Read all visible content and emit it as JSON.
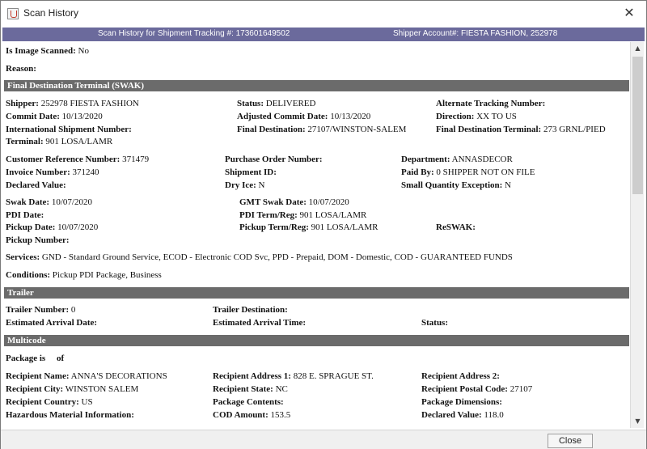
{
  "window": {
    "title": "Scan History",
    "close_symbol": "✕"
  },
  "infobar": {
    "left": "Scan History for Shipment Tracking #:  173601649502",
    "right": "Shipper Account#: FIESTA FASHION,  252978"
  },
  "general": {
    "image_scanned_label": "Is Image Scanned:",
    "image_scanned_value": "No",
    "reason_label": "Reason:"
  },
  "sections": {
    "fdt": "Final Destination Terminal (SWAK)",
    "trailer": "Trailer",
    "multicode": "Multicode"
  },
  "shipment": {
    "shipper_label": "Shipper:",
    "shipper_value": "252978 FIESTA FASHION",
    "status_label": "Status:",
    "status_value": "DELIVERED",
    "alt_tracking_label": "Alternate Tracking Number:",
    "commit_date_label": "Commit Date:",
    "commit_date_value": "10/13/2020",
    "adj_commit_label": "Adjusted Commit Date:",
    "adj_commit_value": "10/13/2020",
    "direction_label": "Direction:",
    "direction_value": "XX TO US",
    "intl_label": "International Shipment Number:",
    "final_dest_label": "Final Destination:",
    "final_dest_value": "27107/WINSTON-SALEM",
    "fdt_label": "Final Destination Terminal:",
    "fdt_value": "273 GRNL/PIED",
    "terminal_label": "Terminal:",
    "terminal_value": "901 LOSA/LAMR",
    "cust_ref_label": "Customer Reference Number:",
    "cust_ref_value": "371479",
    "po_label": "Purchase Order Number:",
    "dept_label": "Department:",
    "dept_value": "ANNASDECOR",
    "invoice_label": "Invoice Number:",
    "invoice_value": "371240",
    "shipment_id_label": "Shipment ID:",
    "paid_by_label": "Paid By:",
    "paid_by_value": "0 SHIPPER NOT ON FILE",
    "declared_label": "Declared Value:",
    "dry_ice_label": "Dry Ice:",
    "dry_ice_value": "N",
    "small_qty_label": "Small Quantity Exception:",
    "small_qty_value": "N",
    "swak_date_label": "Swak Date:",
    "swak_date_value": "10/07/2020",
    "gmt_swak_label": "GMT Swak Date:",
    "gmt_swak_value": "10/07/2020",
    "pdi_date_label": "PDI Date:",
    "pdi_term_label": "PDI Term/Reg:",
    "pdi_term_value": "901 LOSA/LAMR",
    "pickup_date_label": "Pickup Date:",
    "pickup_date_value": "10/07/2020",
    "pickup_term_label": "Pickup Term/Reg:",
    "pickup_term_value": "901 LOSA/LAMR",
    "reswak_label": "ReSWAK:",
    "pickup_number_label": "Pickup Number:",
    "services_label": "Services:",
    "services_value": "GND - Standard Ground Service,  ECOD - Electronic COD Svc,  PPD - Prepaid,  DOM - Domestic,  COD - GUARANTEED FUNDS",
    "conditions_label": "Conditions:",
    "conditions_value": "Pickup PDI Package,  Business"
  },
  "trailer": {
    "number_label": "Trailer Number:",
    "number_value": "0",
    "destination_label": "Trailer Destination:",
    "est_arrival_date_label": "Estimated Arrival Date:",
    "est_arrival_time_label": "Estimated Arrival Time:",
    "status_label": "Status:"
  },
  "multicode": {
    "package_is_label": "Package is",
    "of_label": "of",
    "recipient_name_label": "Recipient Name:",
    "recipient_name_value": "ANNA'S DECORATIONS",
    "addr1_label": "Recipient Address 1:",
    "addr1_value": "828 E. SPRAGUE ST.",
    "addr2_label": "Recipient Address 2:",
    "city_label": "Recipient City:",
    "city_value": "WINSTON SALEM",
    "state_label": "Recipient State:",
    "state_value": "NC",
    "postal_label": "Recipient Postal Code:",
    "postal_value": "27107",
    "country_label": "Recipient Country:",
    "country_value": "US",
    "contents_label": "Package Contents:",
    "dimensions_label": "Package Dimensions:",
    "hazmat_label": "Hazardous Material Information:",
    "cod_label": "COD Amount:",
    "cod_value": "153.5",
    "declared_label": "Declared Value:",
    "declared_value": "118.0"
  },
  "scroll": {
    "up": "▲",
    "down": "▼"
  },
  "footer": {
    "close_label": "Close"
  }
}
